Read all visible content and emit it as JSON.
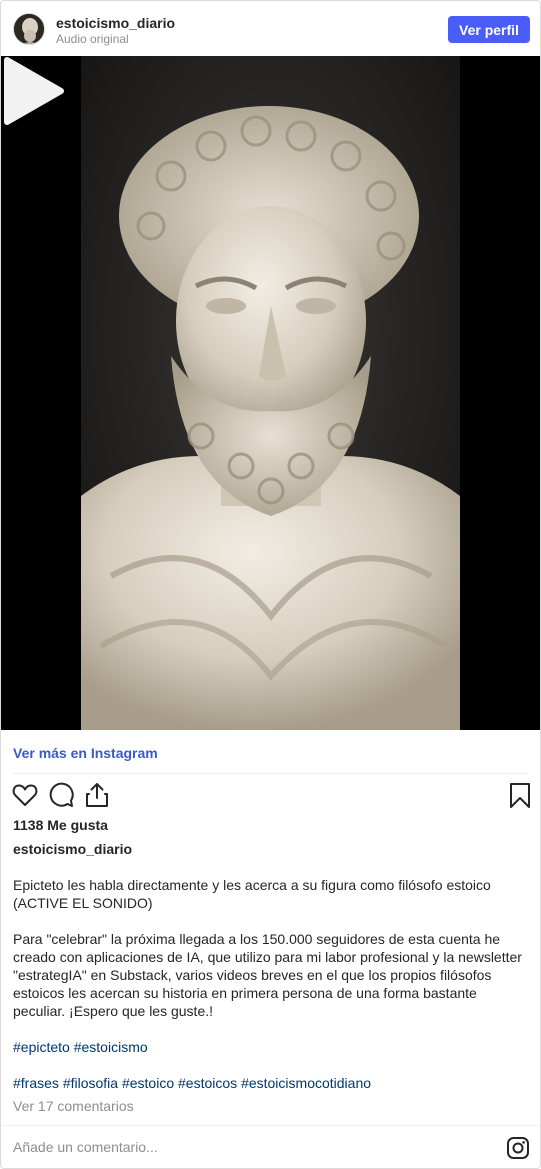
{
  "header": {
    "username": "estoicismo_diario",
    "subtitle": "Audio original",
    "view_profile_label": "Ver perfil"
  },
  "media": {
    "type": "video",
    "subject": "marble bust of a bearded philosopher"
  },
  "see_more_label": "Ver más en Instagram",
  "actions": {
    "icons": [
      "heart-icon",
      "comment-icon",
      "share-icon",
      "bookmark-icon"
    ]
  },
  "likes_text": "1138 Me gusta",
  "caption": {
    "username": "estoicismo_diario",
    "paragraph1": "Epicteto les habla directamente y les acerca a su figura como filósofo estoico (ACTIVE EL SONIDO)",
    "paragraph2": "Para \"celebrar\" la próxima llegada a los 150.000 seguidores de esta cuenta he creado con aplicaciones de IA, que utilizo para mi labor profesional y la newsletter \"estrategIA\" en Substack, varios videos breves en el que los propios filósofos estoicos les acercan su historia en primera persona de una forma bastante peculiar. ¡Espero que les guste.!",
    "hashtags_line1": [
      "#epicteto",
      "#estoicismo"
    ],
    "hashtags_line2": [
      "#frases",
      "#filosofia",
      "#estoico",
      "#estoicos",
      "#estoicismocotidiano"
    ]
  },
  "comments_link": "Ver 17 comentarios",
  "add_comment_placeholder": "Añade un comentario...",
  "colors": {
    "button_blue": "#4a5df9",
    "link_blue": "#3b5ac8",
    "hashtag": "#00376b",
    "muted": "#8e8e8e"
  }
}
